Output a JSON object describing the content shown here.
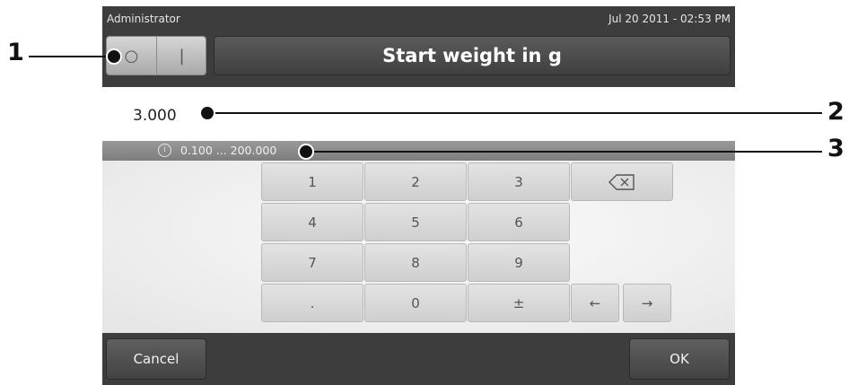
{
  "status": {
    "user": "Administrator",
    "datetime": "Jul 20 2011 - 02:53 PM"
  },
  "toggle": {
    "off_symbol": "○",
    "on_symbol": "|"
  },
  "title": "Start weight in g",
  "entry": {
    "value": "3.000",
    "range": "0.100 ... 200.000",
    "info_symbol": "i"
  },
  "keypad": {
    "rows": [
      [
        "1",
        "2",
        "3"
      ],
      [
        "4",
        "5",
        "6"
      ],
      [
        "7",
        "8",
        "9"
      ],
      [
        ".",
        "0",
        "±"
      ]
    ],
    "left_arrow": "←",
    "right_arrow": "→"
  },
  "buttons": {
    "cancel": "Cancel",
    "ok": "OK"
  },
  "callouts": [
    "1",
    "2",
    "3"
  ],
  "colors": {
    "bar": "#3d3d3d",
    "key": "#d9d9d9"
  },
  "icons": {
    "backspace": "backspace-icon",
    "info": "info-icon"
  }
}
